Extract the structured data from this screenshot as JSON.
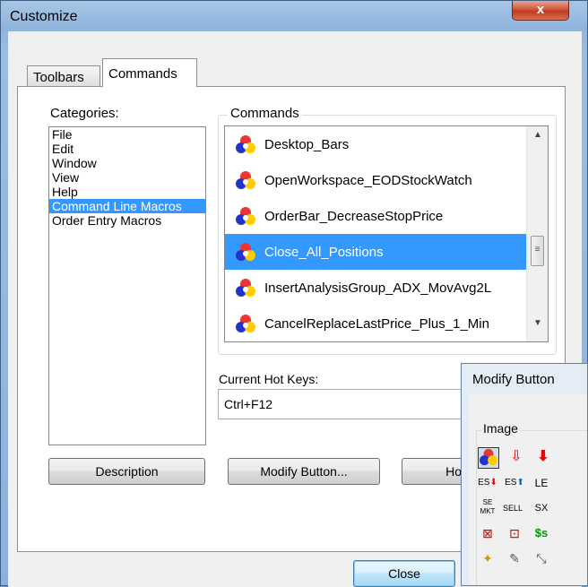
{
  "window": {
    "title": "Customize",
    "close_glyph": "x"
  },
  "tabs": [
    {
      "label": "Toolbars"
    },
    {
      "label": "Commands"
    }
  ],
  "categories": {
    "label": "Categories:",
    "items": [
      "File",
      "Edit",
      "Window",
      "View",
      "Help",
      "Command Line Macros",
      "Order Entry Macros"
    ],
    "selected": "Command Line Macros"
  },
  "commands": {
    "label": "Commands",
    "items": [
      {
        "label": "Desktop_Bars",
        "icon": "macro-icon"
      },
      {
        "label": "OpenWorkspace_EODStockWatch",
        "icon": "macro-icon"
      },
      {
        "label": "OrderBar_DecreaseStopPrice",
        "icon": "macro-icon"
      },
      {
        "label": "Close_All_Positions",
        "icon": "macro-icon"
      },
      {
        "label": "InsertAnalysisGroup_ADX_MovAvg2L",
        "icon": "macro-icon"
      },
      {
        "label": "CancelReplaceLastPrice_Plus_1_Min",
        "icon": "macro-icon"
      }
    ],
    "selected": "Close_All_Positions"
  },
  "hotkeys": {
    "label": "Current Hot Keys:",
    "value": "Ctrl+F12"
  },
  "buttons": {
    "description": "Description",
    "modify": "Modify Button...",
    "hotkey": "Hot",
    "close": "Close"
  },
  "modify_dialog": {
    "title": "Modify Button",
    "image_label": "Image",
    "glyph_texts": [
      "ES",
      "ES",
      "LE",
      "SE MKT",
      "SELL",
      "SX",
      "$s"
    ]
  },
  "colors": {
    "selection": "#3399ff",
    "title_bar": "#9cbde3",
    "close_red": "#c03a1e"
  }
}
